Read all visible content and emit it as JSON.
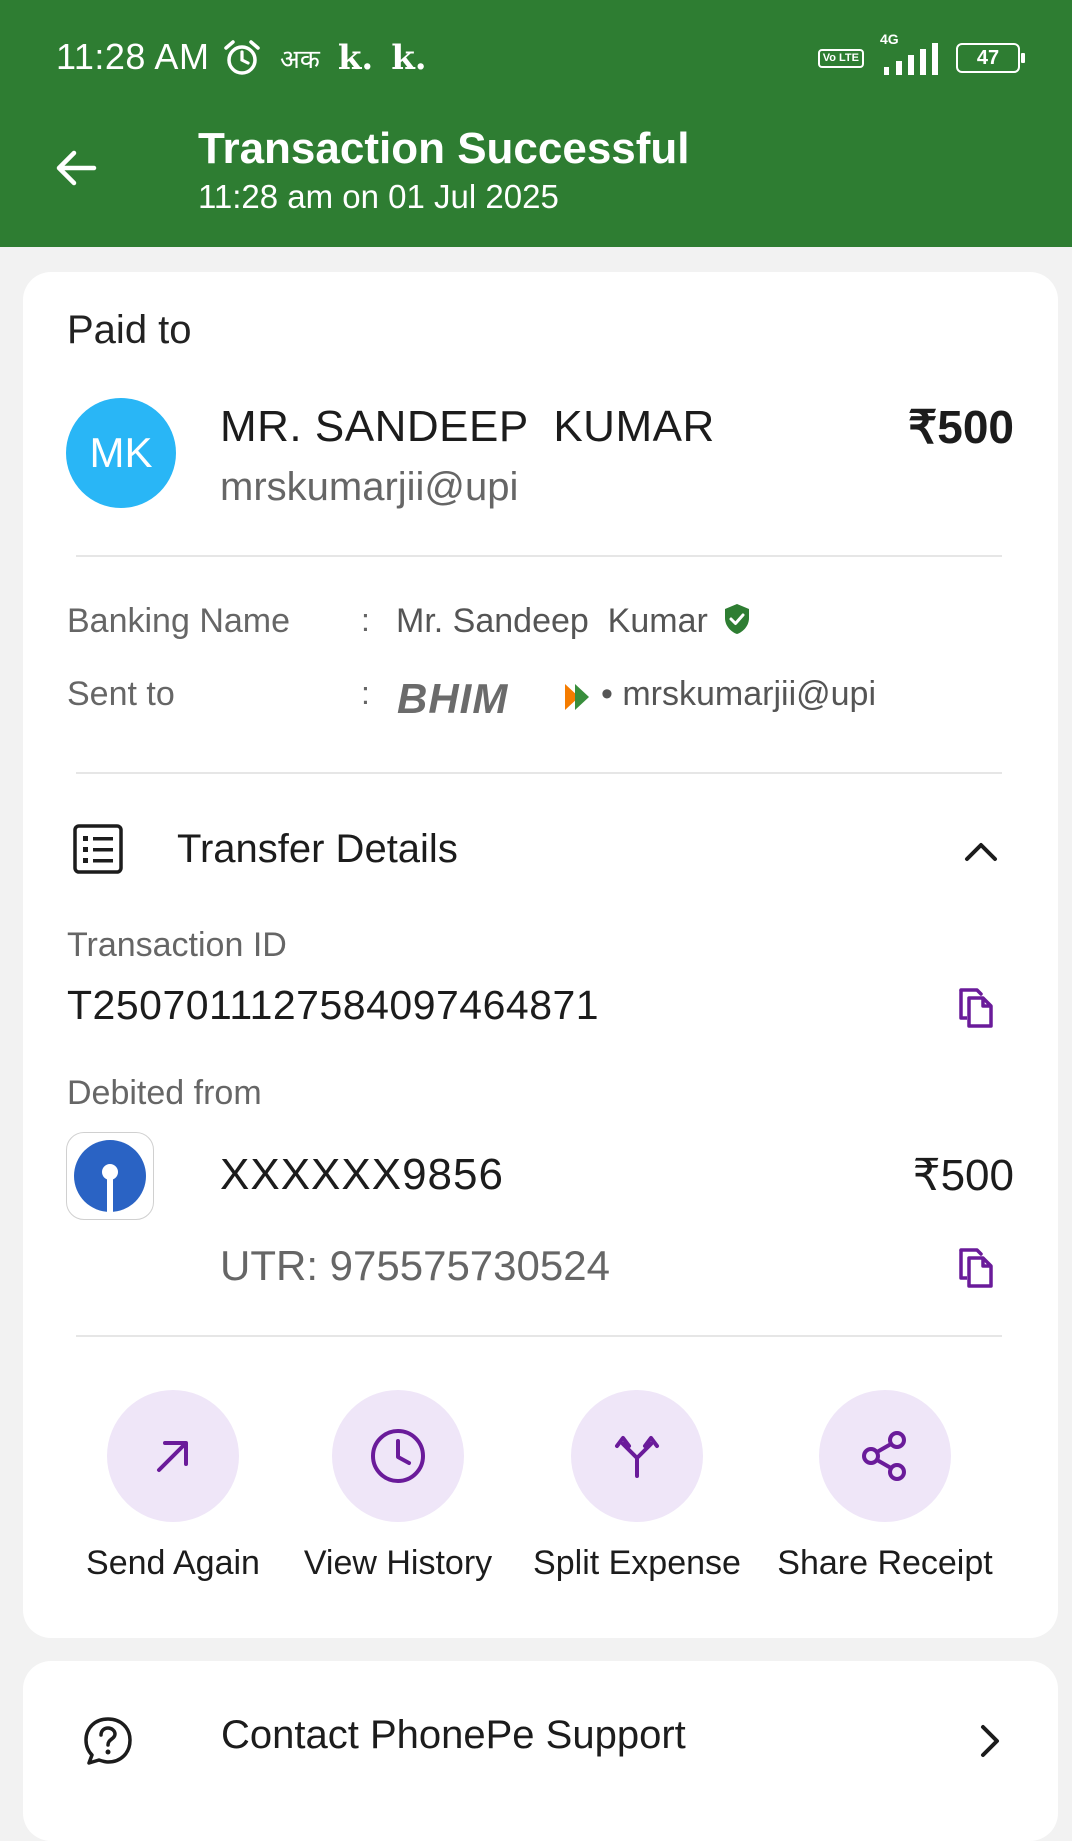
{
  "status_bar": {
    "time": "11:28 AM",
    "hindi_icon": "अक",
    "k_icons": [
      "k.",
      "k."
    ],
    "volte": "Vo LTE",
    "network": "4G",
    "battery": "47"
  },
  "header": {
    "title": "Transaction Successful",
    "subtitle": "11:28 am on 01 Jul 2025"
  },
  "paid_to": {
    "label": "Paid to",
    "avatar_initials": "MK",
    "name": "MR. SANDEEP  KUMAR",
    "upi_id": "mrskumarjii@upi",
    "amount": "₹500"
  },
  "details": {
    "banking_name_label": "Banking Name",
    "banking_name_value": "Mr. Sandeep  Kumar",
    "sent_to_label": "Sent to",
    "sent_to_app": "BHIM",
    "sent_to_value": "• mrskumarjii@upi",
    "separator": ":"
  },
  "transfer": {
    "title": "Transfer Details",
    "txn_id_label": "Transaction ID",
    "txn_id": "T2507011127584097464871",
    "debited_label": "Debited from",
    "account": "XXXXXX9856",
    "amount": "₹500",
    "utr": "UTR: 975575730524"
  },
  "actions": [
    {
      "label": "Send Again",
      "icon": "arrow-up-right-icon"
    },
    {
      "label": "View History",
      "icon": "clock-icon"
    },
    {
      "label": "Split Expense",
      "icon": "split-icon"
    },
    {
      "label": "Share Receipt",
      "icon": "share-icon"
    }
  ],
  "support": {
    "label": "Contact PhonePe Support"
  },
  "colors": {
    "header_green": "#2e7d32",
    "accent_purple": "#6a1b9a",
    "action_bg": "#efe6f8",
    "avatar_blue": "#29b6f6",
    "sbi_blue": "#2a63c4",
    "verified_green": "#2e7d32"
  }
}
